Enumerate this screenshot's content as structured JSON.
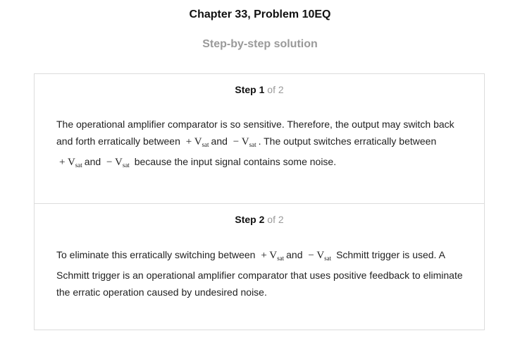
{
  "header": {
    "title": "Chapter 33, Problem 10EQ",
    "subtitle": "Step-by-step solution"
  },
  "steps": [
    {
      "label": "Step",
      "number": "1",
      "of_total": "of 2",
      "text": {
        "t1": "The operational amplifier comparator is so sensitive. Therefore, the output may switch back and forth erratically between",
        "t2": "and",
        "t3": ". The output switches erratically between",
        "t4": "and",
        "t5": "because the input signal contains some noise."
      }
    },
    {
      "label": "Step",
      "number": "2",
      "of_total": "of 2",
      "text": {
        "t1": "To eliminate this erratically switching between",
        "t2": "and",
        "t3": "Schmitt trigger is used. A Schmitt trigger is an operational amplifier comparator that uses positive feedback to eliminate the erratic operation caused by undesired noise."
      }
    }
  ],
  "math": {
    "plus_vsat": "+ V",
    "minus_vsat": "− V",
    "sat": "sat"
  }
}
